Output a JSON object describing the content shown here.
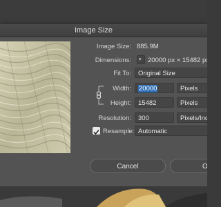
{
  "dialog": {
    "title": "Image Size"
  },
  "image_size": {
    "label": "Image Size:",
    "value": "885.9M"
  },
  "dimensions": {
    "label": "Dimensions:",
    "value": "20000 px  ×  15482 px"
  },
  "fit_to": {
    "label": "Fit To:",
    "value": "Original Size"
  },
  "width": {
    "label": "Width:",
    "value": "20000",
    "unit": "Pixels"
  },
  "height": {
    "label": "Height:",
    "value": "15482",
    "unit": "Pixels"
  },
  "resolution": {
    "label": "Resolution:",
    "value": "300",
    "unit": "Pixels/Inch"
  },
  "resample": {
    "label": "Resample:",
    "checked": true,
    "value": "Automatic"
  },
  "buttons": {
    "cancel": "Cancel",
    "ok": "OK"
  }
}
